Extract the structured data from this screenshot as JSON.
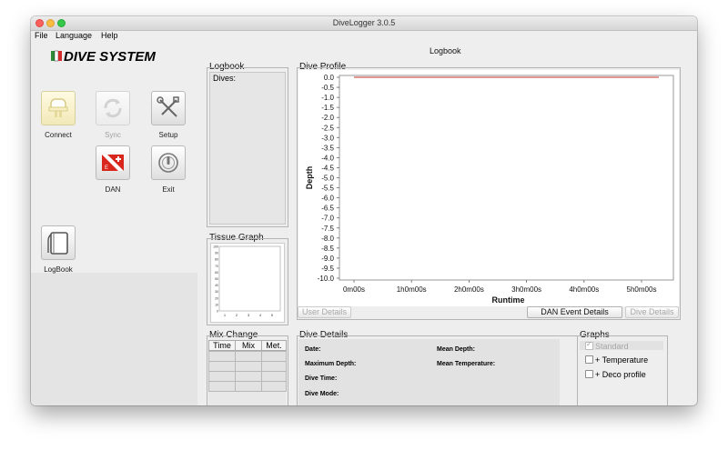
{
  "window": {
    "title": "DiveLogger 3.0.5"
  },
  "menu": {
    "items": [
      "File",
      "Language",
      "Help"
    ]
  },
  "brand": {
    "logo_text": "DIVE SYSTEM"
  },
  "header": {
    "title": "Logbook"
  },
  "toolbar": {
    "connect_label": "Connect",
    "sync_label": "Sync",
    "setup_label": "Setup",
    "dan_label": "DAN",
    "exit_label": "Exit",
    "logbook_label": "LogBook"
  },
  "logbook": {
    "title": "Logbook",
    "dives_label": "Dives:"
  },
  "tissue_graph": {
    "title": "Tissue Graph",
    "y_ticks": [
      "100",
      "90",
      "80",
      "70",
      "60",
      "50",
      "40",
      "30",
      "20",
      "10",
      "0"
    ],
    "x_ticks": [
      "1",
      "2",
      "3",
      "4",
      "5"
    ]
  },
  "mix_change": {
    "title": "Mix Change",
    "columns": [
      "Time",
      "Mix",
      "Met."
    ],
    "rows": 4
  },
  "dive_profile": {
    "title": "Dive Profile"
  },
  "chart_data": {
    "type": "line",
    "title": "",
    "xlabel": "Runtime",
    "ylabel": "Depth",
    "x_ticks": [
      "0m00s",
      "1h0m00s",
      "2h0m00s",
      "3h0m00s",
      "4h0m00s",
      "5h0m00s"
    ],
    "xlim": [
      0,
      5
    ],
    "y_ticks": [
      "0.0",
      "-0.5",
      "-1.0",
      "-1.5",
      "-2.0",
      "-2.5",
      "-3.0",
      "-3.5",
      "-4.0",
      "-4.5",
      "-5.0",
      "-5.5",
      "-6.0",
      "-6.5",
      "-7.0",
      "-7.5",
      "-8.0",
      "-8.5",
      "-9.0",
      "-9.5",
      "-10.0"
    ],
    "ylim": [
      -10.0,
      0.0
    ],
    "series": [
      {
        "values": [
          [
            0,
            0.0
          ],
          [
            5.3,
            0.0
          ]
        ],
        "color": "#c4302b"
      }
    ]
  },
  "buttons": {
    "user_details": "User Details",
    "dan_event_details": "DAN Event Details",
    "dive_details": "Dive Details"
  },
  "dive_details": {
    "title": "Dive Details",
    "date_label": "Date:",
    "max_depth_label": "Maximum Depth:",
    "dive_time_label": "Dive Time:",
    "dive_mode_label": "Dive Mode:",
    "mean_depth_label": "Mean Depth:",
    "mean_temp_label": "Mean Temperature:"
  },
  "graphs": {
    "title": "Graphs",
    "standard": "Standard",
    "temperature": "+ Temperature",
    "deco_profile": "+ Deco profile"
  }
}
